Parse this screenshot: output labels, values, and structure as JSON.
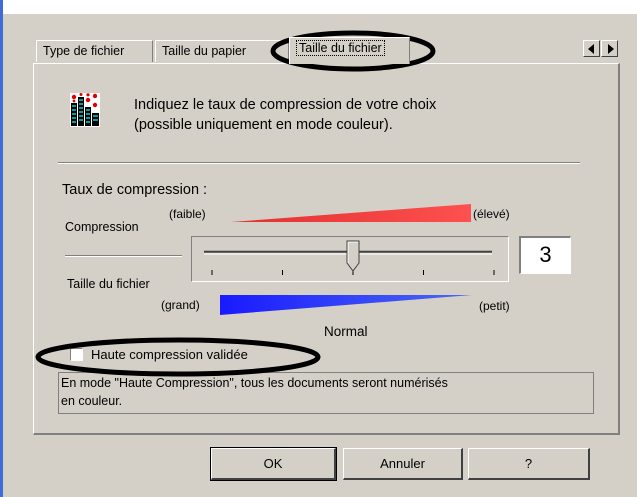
{
  "tabs": [
    {
      "label": "Type de fichier"
    },
    {
      "label": "Taille du papier"
    },
    {
      "label": "Taille du fichier",
      "active": true
    }
  ],
  "tab_scroll": {
    "left_icon": "arrow-left",
    "right_icon": "arrow-right"
  },
  "intro": {
    "icon": "compression-bars-icon",
    "line1": "Indiquez le taux de compression de votre choix",
    "line2": "(possible uniquement en mode couleur)."
  },
  "compression": {
    "title": "Taux de compression :",
    "compression_label": "Compression",
    "low_label": "(faible)",
    "high_label": "(élevé)",
    "file_size_label": "Taille du fichier",
    "large_label": "(grand)",
    "small_label": "(petit)",
    "slider": {
      "min": 1,
      "max": 5,
      "value": 3
    },
    "value_display": "3",
    "mode_label": "Normal"
  },
  "high_compression": {
    "label": "Haute compression validée",
    "checked": false
  },
  "info": {
    "line1": "En mode \"Haute Compression\", tous les documents seront numérisés",
    "line2": "en couleur."
  },
  "buttons": {
    "ok": "OK",
    "cancel": "Annuler",
    "help": "?"
  },
  "colors": {
    "red_gradient": "#ff4040",
    "blue_gradient": "#2020ff",
    "annotation": "#000000"
  }
}
